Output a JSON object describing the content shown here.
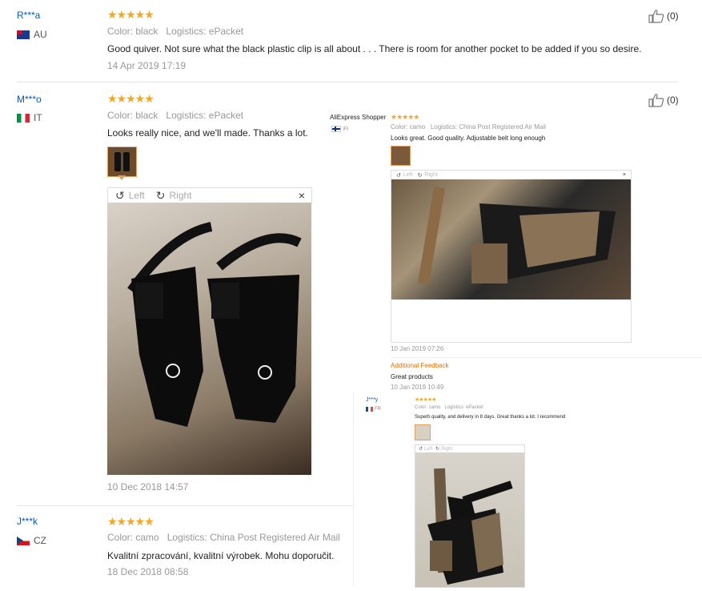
{
  "reviews": [
    {
      "name": "R***a",
      "country": "AU",
      "stars": "★★★★★",
      "color_label": "Color:",
      "color": "black",
      "logistics_label": "Logistics:",
      "logistics": "ePacket",
      "text": "Good quiver. Not sure what the black plastic clip is all about . . . There is room for another pocket to be added if you so desire.",
      "date": "14 Apr 2019 17:19",
      "likes": "(0)"
    },
    {
      "name": "M***o",
      "country": "IT",
      "stars": "★★★★★",
      "color_label": "Color:",
      "color": "black",
      "logistics_label": "Logistics:",
      "logistics": "ePacket",
      "text": "Looks really nice, and we'll made. Thanks a lot.",
      "date": "10 Dec 2018 14:57",
      "likes": "(0)",
      "viewer": {
        "left": "Left",
        "right": "Right",
        "close": "×"
      }
    },
    {
      "name": "J***k",
      "country": "CZ",
      "stars": "★★★★★",
      "color_label": "Color:",
      "color": "camo",
      "logistics_label": "Logistics:",
      "logistics": "China Post Registered Air Mail",
      "text": "Kvalitní zpracování, kvalitní výrobek. Mohu doporučit.",
      "date": "18 Dec 2018 08:58"
    }
  ],
  "overlay1": {
    "name": "AliExpress Shopper",
    "stars": "★★★★★",
    "country": "FI",
    "color_label": "Color:",
    "color": "camo",
    "logistics_label": "Logistics:",
    "logistics": "China Post Registered Air Mail",
    "text": "Looks great. Good quality. Adjustable belt long enough",
    "viewer": {
      "left": "Left",
      "right": "Right",
      "close": "×"
    },
    "date": "10 Jan 2019 07:26",
    "additional_title": "Additional Feedback",
    "additional_text": "Great products",
    "additional_date": "10 Jan 2019 10:49"
  },
  "overlay2": {
    "name": "J***y",
    "stars": "★★★★★",
    "country": "FR",
    "color_label": "Color:",
    "color": "camo",
    "logistics_label": "Logistics:",
    "logistics": "ePacket",
    "text": "Superb quality, and delivery in 8 days. Great thanks a lot. I recommend",
    "viewer": {
      "left": "Left",
      "right": "Right"
    }
  },
  "colors": {
    "name": "#0a57b4",
    "star": "#f5a623",
    "thumb_border": "#e0a060",
    "additional": "#e07000"
  }
}
